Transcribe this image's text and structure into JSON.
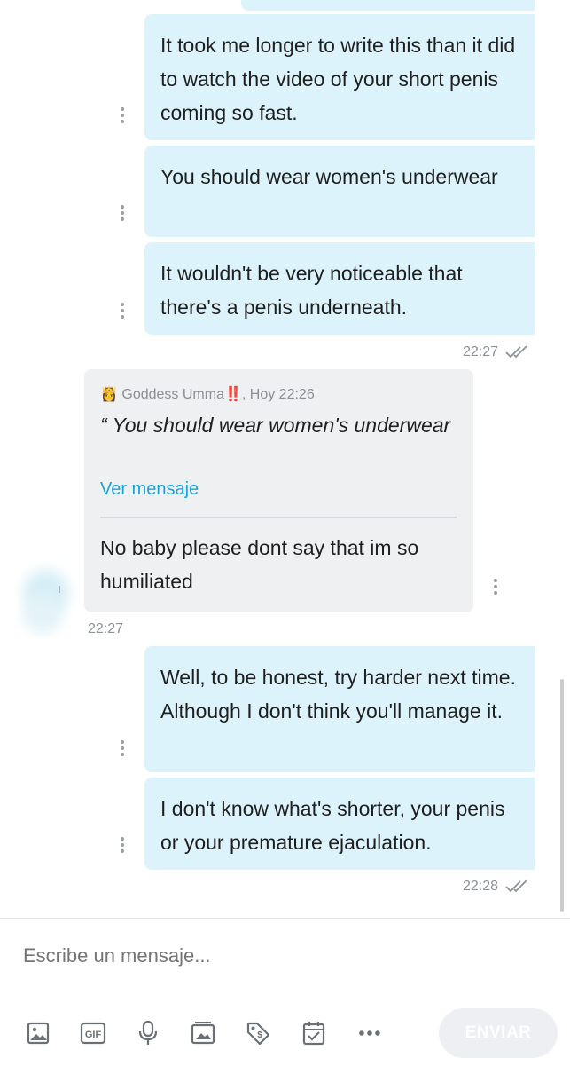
{
  "messages_out_1": [
    "It took me longer to write this than it did to watch the video of your short penis coming so fast.",
    "You should wear women's underwear",
    "It wouldn't be very noticeable that there's a penis underneath."
  ],
  "time_1": "22:27",
  "incoming": {
    "emoji": "👸",
    "author": "Goddess Umma",
    "alert_emoji": "‼️",
    "meta": ", Hoy 22:26",
    "quote": "“ You should wear women's underwear",
    "quote_link": "Ver mensaje",
    "text": "No baby please dont say that im so humiliated",
    "time": "22:27"
  },
  "messages_out_2": [
    "Well, to be honest, try harder next time. Although I don't think you'll manage it.",
    "I don't know what's shorter, your penis or your premature ejaculation."
  ],
  "time_2": "22:28",
  "composer": {
    "placeholder": "Escribe un mensaje...",
    "send_label": "ENVIAR",
    "gif_label": "GIF",
    "tools": [
      "image-icon",
      "gif-icon",
      "microphone-icon",
      "gallery-icon",
      "price-tag-icon",
      "calendar-check-icon",
      "more-icon"
    ]
  },
  "colors": {
    "outgoing": "#ddf3fc",
    "incoming": "#eff0f2",
    "link": "#1aa3d6"
  }
}
